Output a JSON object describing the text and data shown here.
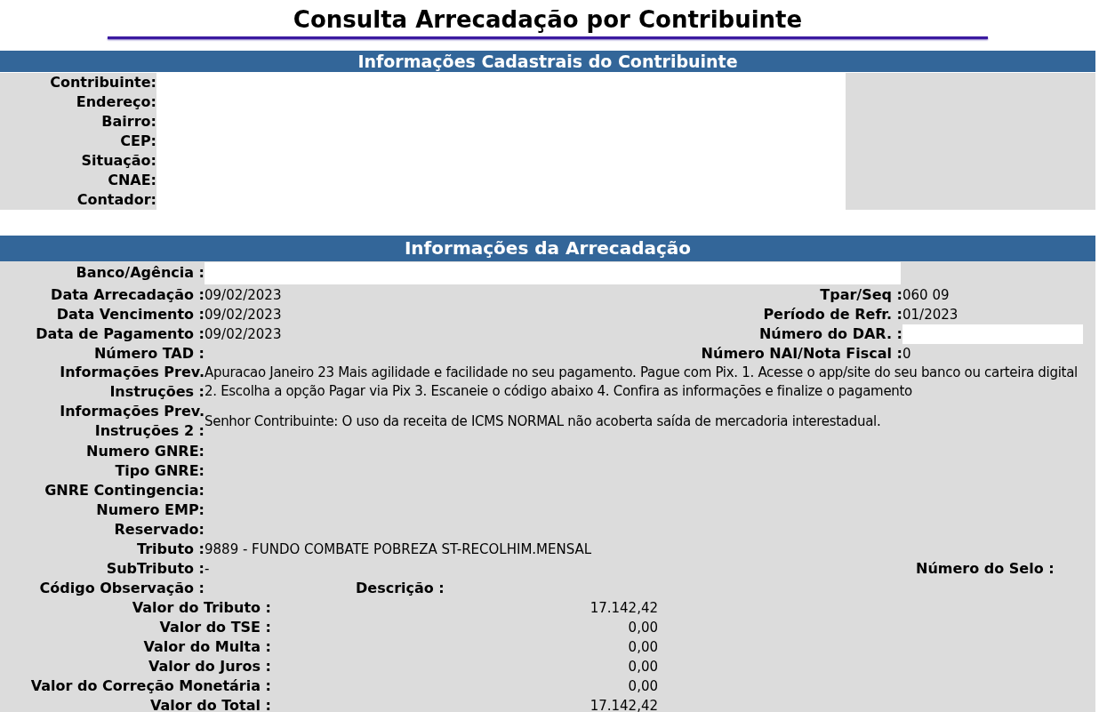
{
  "page_title": "Consulta Arrecadação por Contribuinte",
  "cadastro": {
    "title": "Informações Cadastrais do Contribuinte",
    "labels": [
      "Contribuinte:",
      "Endereço:",
      "Bairro:",
      "CEP:",
      "Situação:",
      "CNAE:",
      "Contador:"
    ]
  },
  "arrecadacao": {
    "title": "Informações da Arrecadação",
    "banco": {
      "label": "Banco/Agência :",
      "redacted": true
    },
    "pair_rows": [
      {
        "left": {
          "label": "Data Arrecadação :",
          "value": "09/02/2023",
          "redacted": false
        },
        "right": {
          "label": "Tpar/Seq :",
          "value": "060 09",
          "redacted": false
        }
      },
      {
        "left": {
          "label": "Data Vencimento :",
          "value": "09/02/2023",
          "redacted": false
        },
        "right": {
          "label": "Período de Refr. :",
          "value": "01/2023",
          "redacted": false
        }
      },
      {
        "left": {
          "label": "Data de Pagamento :",
          "value": "09/02/2023",
          "redacted": false
        },
        "right": {
          "label": "Número do DAR. :",
          "redacted": true
        }
      },
      {
        "left": {
          "label": "Número TAD :",
          "redacted": false
        },
        "right": {
          "label": "Número NAI/Nota Fiscal :",
          "value": "0",
          "redacted": false
        }
      }
    ],
    "info_rows": [
      {
        "label_lines": [
          "Informações Prev.",
          "Instruções :"
        ],
        "value": "Apuracao Janeiro 23 Mais agilidade e facilidade no seu pagamento. Pague com Pix. 1. Acesse o app/site do seu banco ou carteira digital 2. Escolha a opção Pagar via Pix 3. Escaneie o código abaixo 4. Confira as informações e finalize o pagamento"
      },
      {
        "label_lines": [
          "Informações Prev.",
          "Instruções 2 :"
        ],
        "value": "Senhor Contribuinte: O uso da receita de ICMS NORMAL não acoberta saída de mercadoria interestadual."
      }
    ],
    "simple_rows": [
      {
        "label": "Numero GNRE:"
      },
      {
        "label": "Tipo GNRE:"
      },
      {
        "label": "GNRE Contingencia:"
      },
      {
        "label": "Numero EMP:"
      },
      {
        "label": "Reservado:"
      },
      {
        "label": "Tributo :",
        "value": "9889 - FUNDO COMBATE POBREZA ST-RECOLHIM.MENSAL"
      }
    ],
    "subtributo": {
      "label": "SubTributo :",
      "value": "-",
      "right_label": "Número do Selo :"
    },
    "observacao": {
      "label": "Código Observação :",
      "descricao_label": "Descrição :"
    },
    "valores": [
      {
        "label": "Valor do Tributo :",
        "value": "17.142,42"
      },
      {
        "label": "Valor do TSE :",
        "value": "0,00"
      },
      {
        "label": "Valor do Multa :",
        "value": "0,00"
      },
      {
        "label": "Valor do Juros :",
        "value": "0,00"
      },
      {
        "label": "Valor do Correção Monetária :",
        "value": "0,00"
      },
      {
        "label": "Valor do Total :",
        "value": "17.142,42"
      }
    ]
  }
}
